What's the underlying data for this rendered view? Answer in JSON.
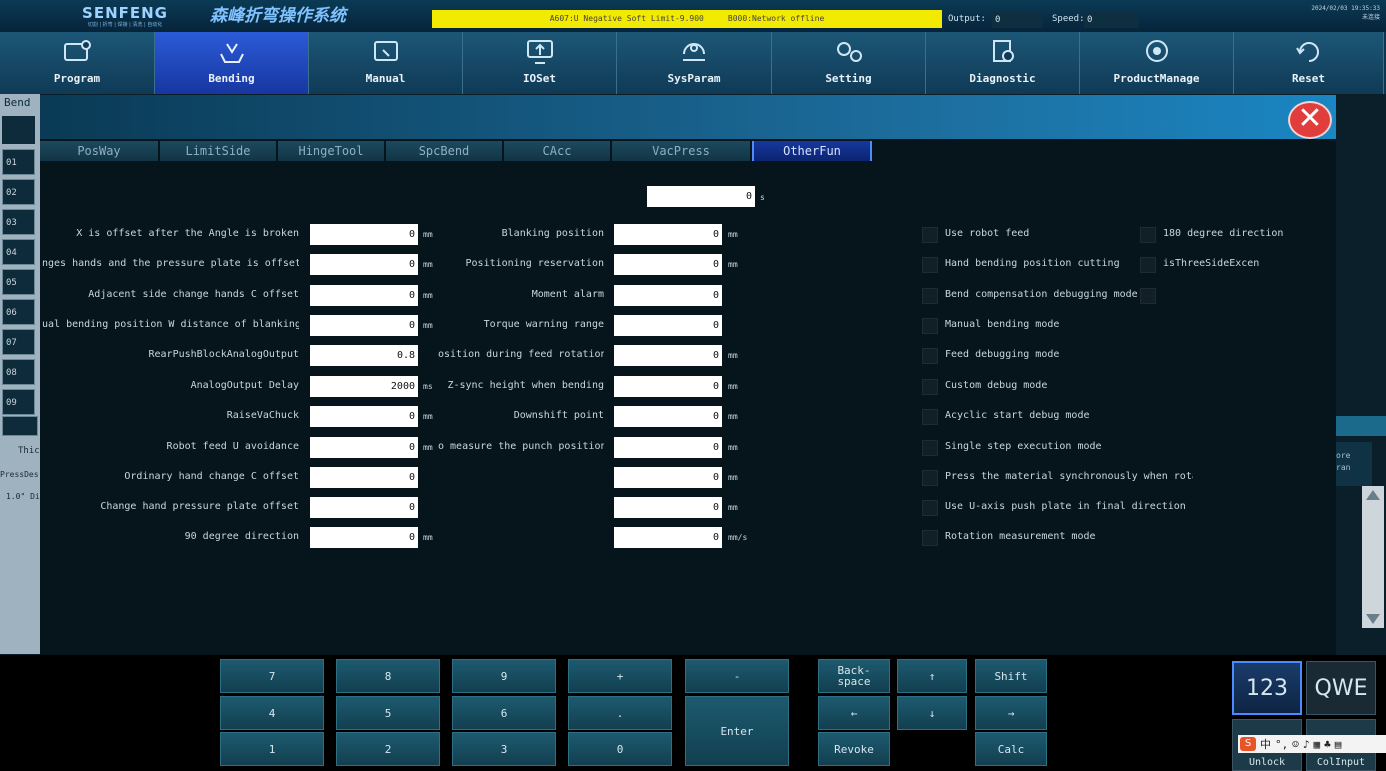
{
  "header": {
    "brand": "SENFENG",
    "brand_tagline": "切割 | 折弯 | 焊接 | 清洗 | 自动化",
    "system_title": "森峰折弯操作系统",
    "alarm_text": "A607:U Negative Soft Limit-9.900     B000:Network offline",
    "output_label": "Output:",
    "output_value": "0",
    "speed_label": "Speed:",
    "speed_value": "0",
    "date": "2024/02/03 19:35:33",
    "user": "未连接"
  },
  "nav": [
    {
      "label": "Program",
      "icon": "program-icon",
      "active": false
    },
    {
      "label": "Bending",
      "icon": "bending-icon",
      "active": true
    },
    {
      "label": "Manual",
      "icon": "manual-icon",
      "active": false
    },
    {
      "label": "IOSet",
      "icon": "ioset-icon",
      "active": false
    },
    {
      "label": "SysParam",
      "icon": "sysparam-icon",
      "active": false
    },
    {
      "label": "Setting",
      "icon": "gears-icon",
      "active": false
    },
    {
      "label": "Diagnostic",
      "icon": "diagnostic-icon",
      "active": false
    },
    {
      "label": "ProductManage",
      "icon": "product-icon",
      "active": false
    },
    {
      "label": "Reset",
      "icon": "reset-icon",
      "active": false
    }
  ],
  "left_panel": {
    "title": "Bend",
    "rows": [
      "01",
      "02",
      "03",
      "04",
      "05",
      "06",
      "07",
      "08",
      "09"
    ],
    "text1": "Thic",
    "text2": "PressDes",
    "text3": "1.0\" Di"
  },
  "right_panel": {
    "text": "ore\nran"
  },
  "tabs": [
    {
      "label": "PosWay",
      "active": false
    },
    {
      "label": "LimitSide",
      "active": false
    },
    {
      "label": "HingeTool",
      "active": false
    },
    {
      "label": "SpcBend",
      "active": false
    },
    {
      "label": "CAcc",
      "active": false
    },
    {
      "label": "VacPress",
      "active": false
    },
    {
      "label": "OtherFun",
      "active": true
    }
  ],
  "top_field": {
    "value": "0",
    "unit": "s"
  },
  "left_fields": [
    {
      "label": "X is offset after the Angle is broken",
      "value": "0",
      "unit": "mm"
    },
    {
      "label": "nges hands and the pressure plate is offset",
      "value": "0",
      "unit": "mm"
    },
    {
      "label": "Adjacent side change hands C offset",
      "value": "0",
      "unit": "mm"
    },
    {
      "label": "ual bending position W distance of blanking",
      "value": "0",
      "unit": "mm"
    },
    {
      "label": "RearPushBlockAnalogOutput",
      "value": "0.8",
      "unit": ""
    },
    {
      "label": "AnalogOutput Delay",
      "value": "2000",
      "unit": "ms"
    },
    {
      "label": "RaiseVaChuck",
      "value": "0",
      "unit": "mm"
    },
    {
      "label": "Robot feed U avoidance",
      "value": "0",
      "unit": "mm"
    },
    {
      "label": "Ordinary hand change C offset",
      "value": "0",
      "unit": ""
    },
    {
      "label": "Change hand pressure plate offset",
      "value": "0",
      "unit": ""
    },
    {
      "label": "90 degree direction",
      "value": "0",
      "unit": "mm"
    }
  ],
  "mid_fields": [
    {
      "label": "Blanking position",
      "value": "0",
      "unit": "mm"
    },
    {
      "label": "Positioning reservation",
      "value": "0",
      "unit": "mm"
    },
    {
      "label": "Moment alarm",
      "value": "0",
      "unit": ""
    },
    {
      "label": "Torque warning range",
      "value": "0",
      "unit": ""
    },
    {
      "label": "osition during feed rotation",
      "value": "0",
      "unit": "mm"
    },
    {
      "label": "Z-sync height when bending",
      "value": "0",
      "unit": "mm"
    },
    {
      "label": "Downshift point",
      "value": "0",
      "unit": "mm"
    },
    {
      "label": "o measure the punch position",
      "value": "0",
      "unit": "mm"
    },
    {
      "label": "",
      "value": "0",
      "unit": "mm"
    },
    {
      "label": "",
      "value": "0",
      "unit": "mm"
    },
    {
      "label": "",
      "value": "0",
      "unit": "mm/s"
    }
  ],
  "checkboxes_col1": [
    "Use robot feed",
    "Hand bending position cutting",
    "Bend compensation debugging mode",
    "Manual bending mode",
    "Feed debugging mode",
    "Custom debug mode",
    "Acyclic start debug mode",
    "Single step execution mode",
    "Press the material synchronously when rota",
    "Use U-axis push plate in final direction",
    "Rotation measurement mode"
  ],
  "checkboxes_col2": [
    "180 degree direction",
    "isThreeSideExcen",
    ""
  ],
  "keypad": {
    "k7": "7",
    "k8": "8",
    "k9": "9",
    "kplus": "+",
    "kminus": "-",
    "k4": "4",
    "k5": "5",
    "k6": "6",
    "kdot": ".",
    "kenter": "Enter",
    "k1": "1",
    "k2": "2",
    "k3": "3",
    "k0": "0",
    "backspace": "Back-\nspace",
    "up": "↑",
    "shift": "Shift",
    "left": "←",
    "down": "↓",
    "right": "→",
    "revoke": "Revoke",
    "calc": "Calc"
  },
  "ime": {
    "mode_123": "123",
    "mode_qwe": "QWE",
    "unlock": "Unlock",
    "colinput": "ColInput",
    "ime_label": "中"
  },
  "colors": {
    "accent": "#1736a0",
    "alarm_bg": "#f2ea00",
    "close": "#e23d3d"
  }
}
